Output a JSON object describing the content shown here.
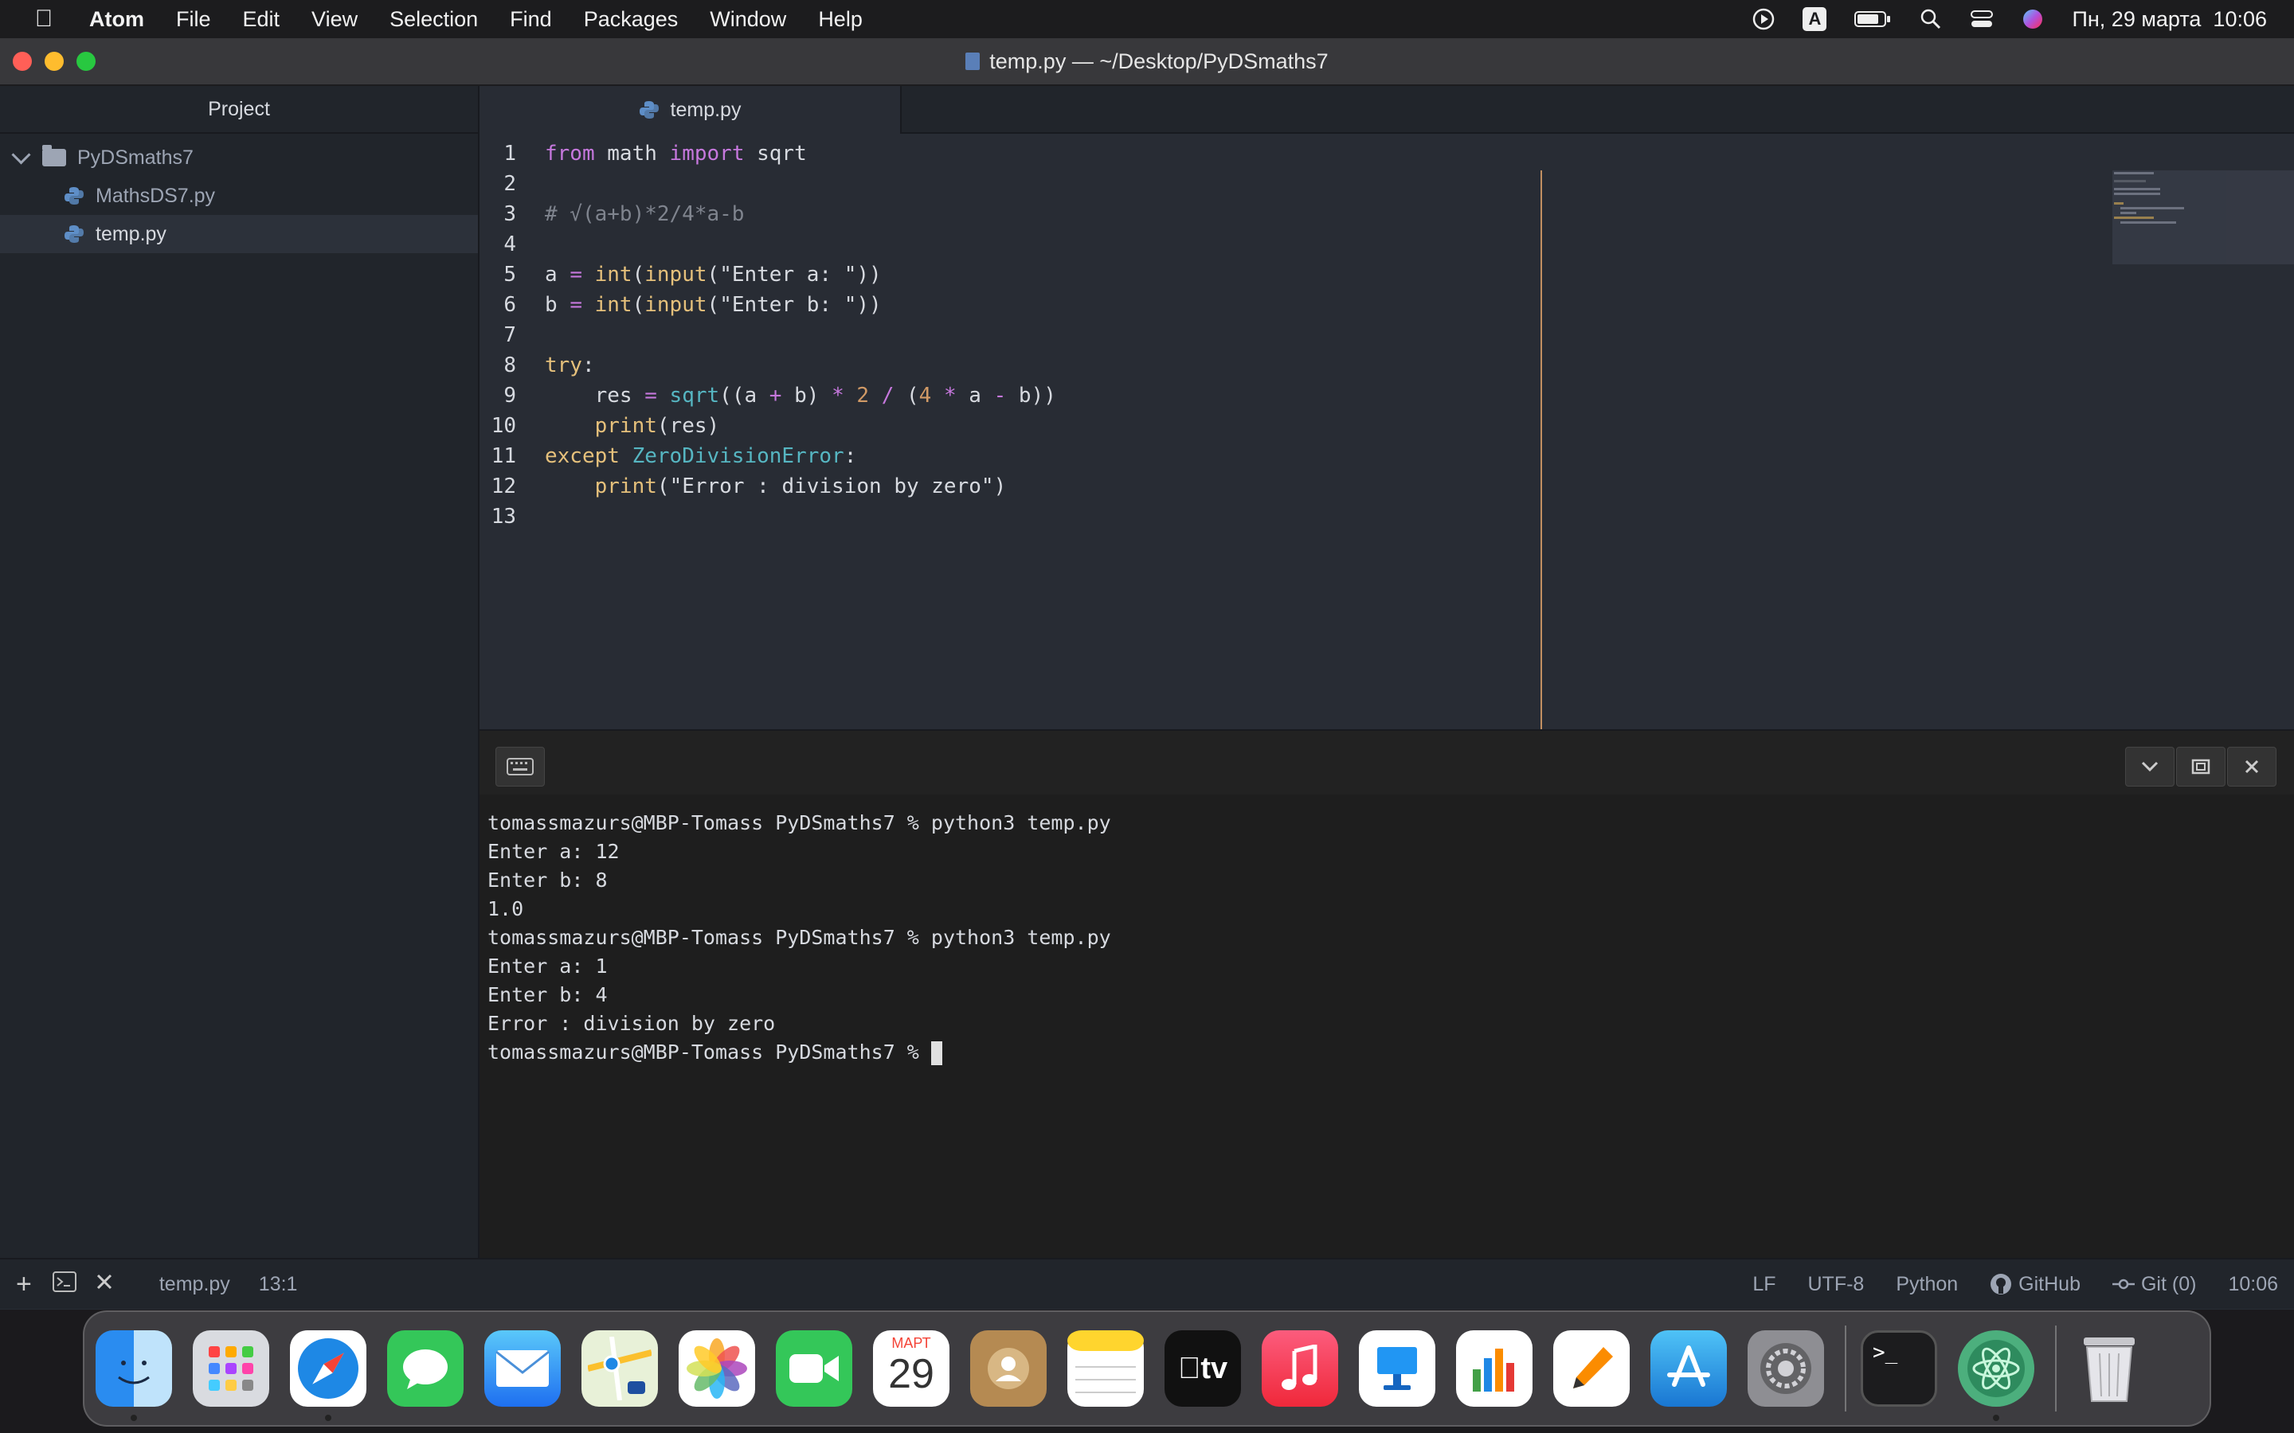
{
  "menubar": {
    "app_name": "Atom",
    "menus": [
      "File",
      "Edit",
      "View",
      "Selection",
      "Find",
      "Packages",
      "Window",
      "Help"
    ],
    "status_letter": "A",
    "datetime": "Пн, 29 марта  10:06"
  },
  "window": {
    "title": "temp.py — ~/Desktop/PyDSmaths7"
  },
  "sidebar": {
    "header": "Project",
    "folder": "PyDSmaths7",
    "files": [
      "MathsDS7.py",
      "temp.py"
    ],
    "selected_file": "temp.py"
  },
  "tab": {
    "label": "temp.py"
  },
  "editor": {
    "line_numbers": [
      "1",
      "2",
      "3",
      "4",
      "5",
      "6",
      "7",
      "8",
      "9",
      "10",
      "11",
      "12",
      "13"
    ]
  },
  "terminal": {
    "lines": [
      "tomassmazurs@MBP-Tomass PyDSmaths7 % python3 temp.py",
      "Enter a: 12",
      "Enter b: 8",
      "1.0",
      "tomassmazurs@MBP-Tomass PyDSmaths7 % python3 temp.py",
      "Enter a: 1",
      "Enter b: 4",
      "Error : division by zero",
      "tomassmazurs@MBP-Tomass PyDSmaths7 % "
    ]
  },
  "statusbar": {
    "file": "temp.py",
    "cursor": "13:1",
    "line_ending": "LF",
    "encoding": "UTF-8",
    "grammar": "Python",
    "github": "GitHub",
    "git": "Git (0)",
    "time": "10:06"
  },
  "dock": {
    "calendar_month": "МАРТ",
    "calendar_day": "29",
    "apps": [
      "finder-icon",
      "launchpad-icon",
      "safari-icon",
      "messages-icon",
      "mail-icon",
      "maps-icon",
      "photos-icon",
      "facetime-icon",
      "calendar-icon",
      "contacts-icon",
      "notes-icon",
      "tv-icon",
      "music-icon",
      "keynote-icon",
      "numbers-icon",
      "pages-icon",
      "app-store-icon",
      "system-preferences-icon",
      "terminal-icon",
      "atom-icon",
      "trash-icon"
    ]
  },
  "colors": {
    "editor_bg": "#282c34",
    "sidebar_bg": "#21252b",
    "terminal_bg": "#1e1e1e",
    "wrap_guide": "#d19a66"
  }
}
